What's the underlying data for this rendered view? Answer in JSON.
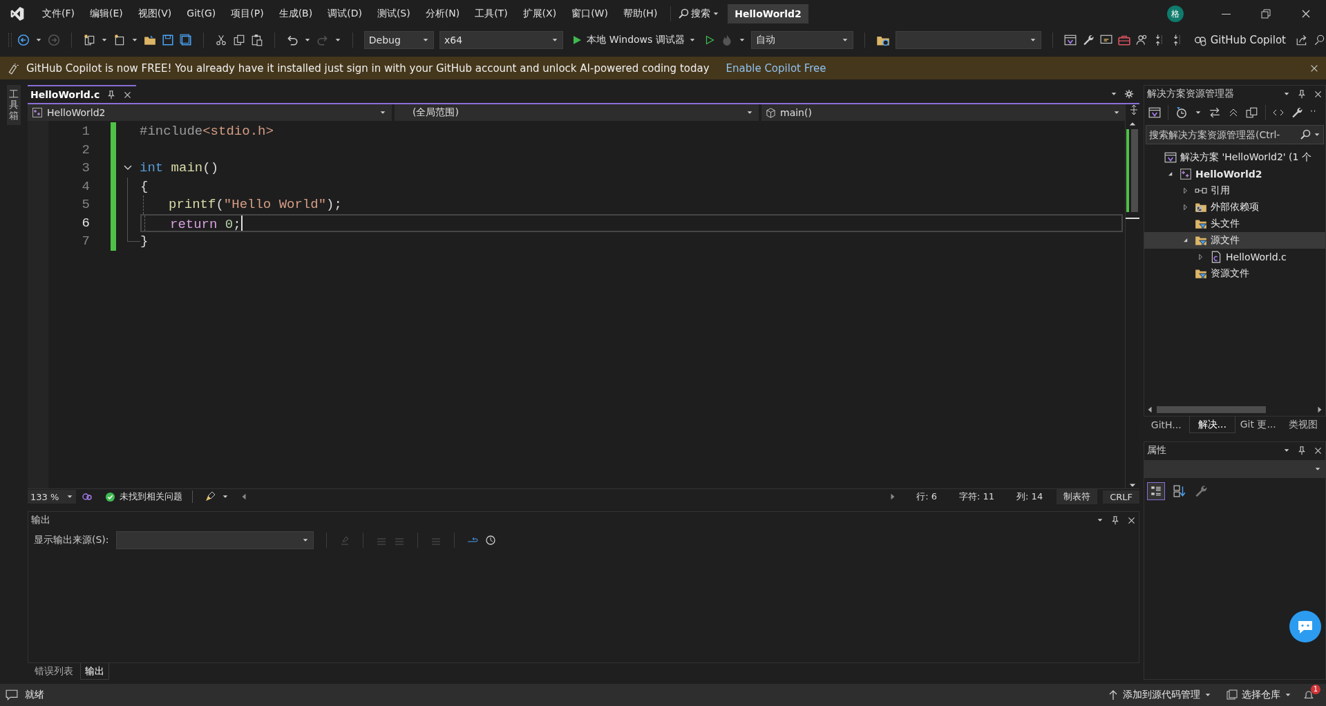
{
  "title_bar": {
    "menu": [
      "文件(F)",
      "编辑(E)",
      "视图(V)",
      "Git(G)",
      "项目(P)",
      "生成(B)",
      "调试(D)",
      "测试(S)",
      "分析(N)",
      "工具(T)",
      "扩展(X)",
      "窗口(W)",
      "帮助(H)"
    ],
    "search": "搜索",
    "solution_name": "HelloWorld2",
    "avatar": "格"
  },
  "toolbar": {
    "configuration": "Debug",
    "platform": "x64",
    "run_label": "本地 Windows 调试器",
    "run_target": "自动",
    "copilot": "GitHub Copilot"
  },
  "infobar": {
    "message": "GitHub Copilot is now FREE! You already have it installed just sign in with your GitHub account and unlock AI-powered coding today",
    "link": "Enable Copilot Free"
  },
  "toolbox": {
    "label": "工具箱"
  },
  "editor": {
    "tabs": [
      {
        "label": "HelloWorld.c",
        "selected": true
      }
    ],
    "nav": {
      "project": "HelloWorld2",
      "scope": "(全局范围)",
      "member": "main()"
    },
    "lines": [
      {
        "number": "1",
        "indent": false,
        "modified": true,
        "foldable": false,
        "current": false,
        "tokens": [
          {
            "kind": "directive",
            "text": "#include"
          },
          {
            "kind": "string",
            "text": "<stdio.h>"
          }
        ]
      },
      {
        "number": "2",
        "indent": false,
        "modified": true,
        "foldable": false,
        "current": false
      },
      {
        "number": "3",
        "indent": false,
        "modified": true,
        "foldable": true,
        "current": false,
        "tokens": [
          {
            "kind": "keyword",
            "text": "int"
          },
          {
            "kind": "function",
            "text": " main"
          },
          {
            "kind": "punct",
            "text": "()"
          }
        ]
      },
      {
        "number": "4",
        "indent": false,
        "modified": true,
        "foldable": false,
        "current": false,
        "tokens": [
          {
            "kind": "punct",
            "text": "{"
          }
        ]
      },
      {
        "number": "5",
        "indent": true,
        "modified": true,
        "foldable": false,
        "current": false,
        "tokens": [
          {
            "kind": "function",
            "text": "printf"
          },
          {
            "kind": "punct",
            "text": "("
          },
          {
            "kind": "string",
            "text": "\"Hello World\""
          },
          {
            "kind": "punct",
            "text": ");"
          }
        ]
      },
      {
        "number": "6",
        "indent": true,
        "modified": true,
        "foldable": false,
        "current": true,
        "tokens": [
          {
            "kind": "control",
            "text": "return"
          },
          {
            "kind": "number",
            "text": " 0"
          },
          {
            "kind": "punct",
            "text": ";"
          }
        ]
      },
      {
        "number": "7",
        "indent": false,
        "modified": true,
        "foldable": false,
        "current": false,
        "tokens": [
          {
            "kind": "punct",
            "text": "}"
          }
        ]
      }
    ],
    "status": {
      "zoom": "133 %",
      "issues": "未找到相关问题",
      "line": "行: 6",
      "char": "字符: 11",
      "column": "列: 14",
      "indentation": "制表符",
      "line_ending": "CRLF"
    }
  },
  "output": {
    "title": "输出",
    "source_label": "显示输出来源(S):"
  },
  "bottom_tabs": [
    {
      "label": "错误列表",
      "selected": false
    },
    {
      "label": "输出",
      "selected": true
    }
  ],
  "solution_explorer": {
    "title": "解决方案资源管理器",
    "search_placeholder": "搜索解决方案资源管理器(Ctrl-",
    "tree": [
      {
        "kind": "solution",
        "label": "解决方案 'HelloWorld2' (1 个",
        "selected": false,
        "children": [
          {
            "kind": "project",
            "label": "HelloWorld2",
            "expanded": true,
            "selected": false,
            "children": [
              {
                "kind": "references",
                "label": "引用",
                "expanded": false,
                "selected": false
              },
              {
                "kind": "external",
                "label": "外部依赖项",
                "expanded": false,
                "selected": false
              },
              {
                "kind": "filter",
                "label": "头文件",
                "selected": false
              },
              {
                "kind": "filter",
                "label": "源文件",
                "expanded": true,
                "selected": true,
                "children": [
                  {
                    "kind": "file",
                    "label": "HelloWorld.c",
                    "expanded": false,
                    "selected": false
                  }
                ]
              },
              {
                "kind": "filter",
                "label": "资源文件",
                "selected": false
              }
            ]
          }
        ]
      }
    ]
  },
  "panel_tabs": [
    {
      "label": "GitH...",
      "selected": false
    },
    {
      "label": "解决...",
      "selected": true
    },
    {
      "label": "Git 更...",
      "selected": false
    },
    {
      "label": "类视图",
      "selected": false
    }
  ],
  "properties": {
    "title": "属性"
  },
  "status_bar": {
    "state": "就绪",
    "source_control": "添加到源代码管理",
    "repository": "选择仓库",
    "notifications": "1"
  }
}
